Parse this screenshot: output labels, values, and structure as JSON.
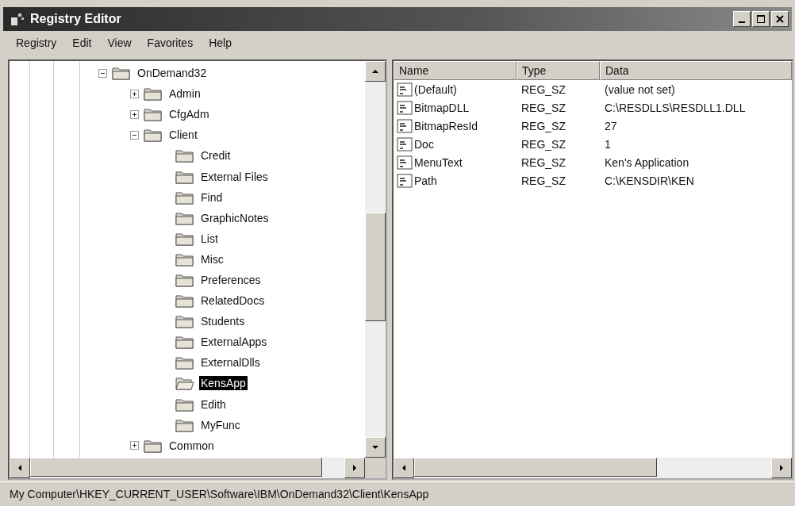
{
  "window": {
    "title": "Registry Editor"
  },
  "menu": [
    "Registry",
    "Edit",
    "View",
    "Favorites",
    "Help"
  ],
  "tree": [
    {
      "label": "OnDemand32",
      "expanded": true,
      "selected": false,
      "children": [
        {
          "label": "Admin",
          "expanded": false,
          "selected": false
        },
        {
          "label": "CfgAdm",
          "expanded": false,
          "selected": false
        },
        {
          "label": "Client",
          "expanded": true,
          "selected": false,
          "children": [
            {
              "label": "Credit",
              "selected": false
            },
            {
              "label": "External Files",
              "selected": false
            },
            {
              "label": "Find",
              "selected": false
            },
            {
              "label": "GraphicNotes",
              "selected": false
            },
            {
              "label": "List",
              "selected": false
            },
            {
              "label": "Misc",
              "selected": false
            },
            {
              "label": "Preferences",
              "selected": false
            },
            {
              "label": "RelatedDocs",
              "selected": false
            },
            {
              "label": "Students",
              "selected": false
            },
            {
              "label": "ExternalApps",
              "selected": false
            },
            {
              "label": "ExternalDlls",
              "selected": false
            },
            {
              "label": "KensApp",
              "selected": true
            },
            {
              "label": "Edith",
              "selected": false
            },
            {
              "label": "MyFunc",
              "selected": false
            }
          ]
        },
        {
          "label": "Common",
          "expanded": false,
          "selected": false
        }
      ]
    }
  ],
  "values": {
    "columns": [
      "Name",
      "Type",
      "Data"
    ],
    "rows": [
      {
        "name": "(Default)",
        "type": "REG_SZ",
        "data": "(value not set)"
      },
      {
        "name": "BitmapDLL",
        "type": "REG_SZ",
        "data": "C:\\RESDLLS\\RESDLL1.DLL"
      },
      {
        "name": "BitmapResId",
        "type": "REG_SZ",
        "data": "27"
      },
      {
        "name": "Doc",
        "type": "REG_SZ",
        "data": "1"
      },
      {
        "name": "MenuText",
        "type": "REG_SZ",
        "data": "Ken's Application"
      },
      {
        "name": "Path",
        "type": "REG_SZ",
        "data": "C:\\KENSDIR\\KEN"
      }
    ]
  },
  "status_bar": "My Computer\\HKEY_CURRENT_USER\\Software\\IBM\\OnDemand32\\Client\\KensApp"
}
